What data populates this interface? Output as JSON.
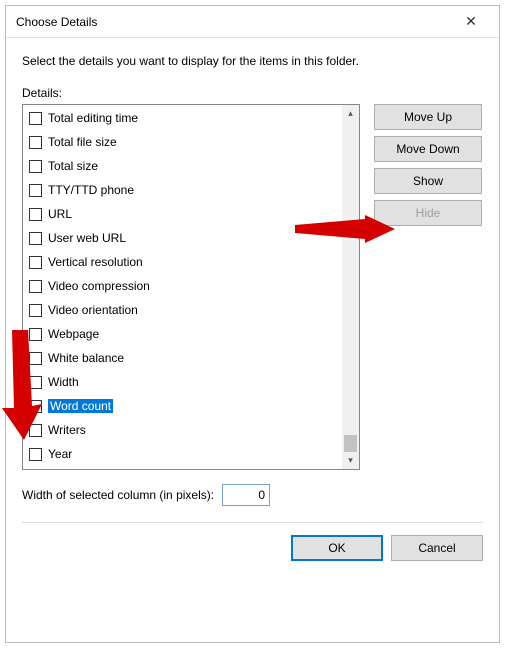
{
  "title": "Choose Details",
  "instruction": "Select the details you want to display for the items in this folder.",
  "details_label": "Details:",
  "items": [
    {
      "label": "Total editing time",
      "checked": false,
      "selected": false
    },
    {
      "label": "Total file size",
      "checked": false,
      "selected": false
    },
    {
      "label": "Total size",
      "checked": false,
      "selected": false
    },
    {
      "label": "TTY/TTD phone",
      "checked": false,
      "selected": false
    },
    {
      "label": "URL",
      "checked": false,
      "selected": false
    },
    {
      "label": "User web URL",
      "checked": false,
      "selected": false
    },
    {
      "label": "Vertical resolution",
      "checked": false,
      "selected": false
    },
    {
      "label": "Video compression",
      "checked": false,
      "selected": false
    },
    {
      "label": "Video orientation",
      "checked": false,
      "selected": false
    },
    {
      "label": "Webpage",
      "checked": false,
      "selected": false
    },
    {
      "label": "White balance",
      "checked": false,
      "selected": false
    },
    {
      "label": "Width",
      "checked": false,
      "selected": false
    },
    {
      "label": "Word count",
      "checked": false,
      "selected": true
    },
    {
      "label": "Writers",
      "checked": false,
      "selected": false
    },
    {
      "label": "Year",
      "checked": false,
      "selected": false
    }
  ],
  "buttons": {
    "move_up": "Move Up",
    "move_down": "Move Down",
    "show": "Show",
    "hide": "Hide",
    "ok": "OK",
    "cancel": "Cancel"
  },
  "width_label": "Width of selected column (in pixels):",
  "width_value": "0",
  "close_glyph": "✕"
}
